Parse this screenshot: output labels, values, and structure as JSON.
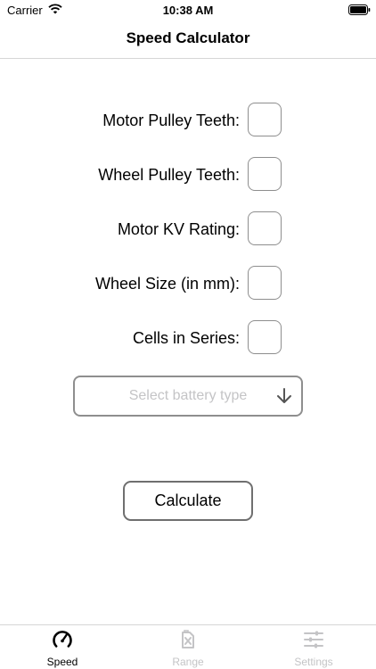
{
  "status_bar": {
    "carrier": "Carrier",
    "time": "10:38 AM"
  },
  "nav": {
    "title": "Speed Calculator"
  },
  "form": {
    "rows": [
      {
        "label": "Motor Pulley Teeth:",
        "value": ""
      },
      {
        "label": "Wheel Pulley Teeth:",
        "value": ""
      },
      {
        "label": "Motor KV Rating:",
        "value": ""
      },
      {
        "label": "Wheel Size (in mm):",
        "value": ""
      },
      {
        "label": "Cells in Series:",
        "value": ""
      }
    ],
    "battery_select": {
      "placeholder": "Select battery type",
      "icon": "arrow-down-icon"
    },
    "calculate_label": "Calculate"
  },
  "tabs": [
    {
      "label": "Speed",
      "icon": "speedometer-icon",
      "active": true
    },
    {
      "label": "Range",
      "icon": "fuel-can-icon",
      "active": false
    },
    {
      "label": "Settings",
      "icon": "sliders-icon",
      "active": false
    }
  ],
  "colors": {
    "active_tab": "#000000",
    "inactive_tab": "#c4c4c6",
    "placeholder": "#c4c4c6",
    "border": "#8e8e8e"
  }
}
